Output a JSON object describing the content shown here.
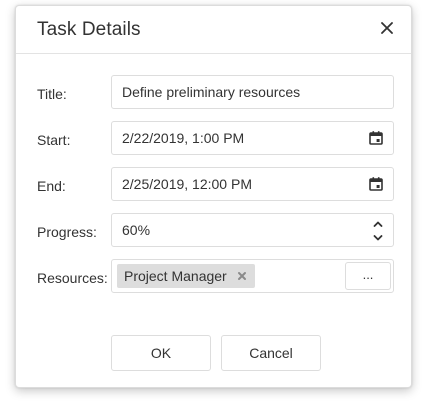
{
  "dialog": {
    "title": "Task Details",
    "close_icon": "close-icon"
  },
  "form": {
    "title": {
      "label": "Title:",
      "value": "Define preliminary resources"
    },
    "start": {
      "label": "Start:",
      "value": "2/22/2019, 1:00 PM",
      "icon": "calendar-icon"
    },
    "end": {
      "label": "End:",
      "value": "2/25/2019, 12:00 PM",
      "icon": "calendar-icon"
    },
    "progress": {
      "label": "Progress:",
      "value": "60%",
      "up_icon": "chevron-up-icon",
      "down_icon": "chevron-down-icon"
    },
    "resources": {
      "label": "Resources:",
      "tags": [
        {
          "label": "Project Manager",
          "remove_icon": "close-icon"
        }
      ],
      "more_button": "..."
    }
  },
  "buttons": {
    "ok": "OK",
    "cancel": "Cancel"
  }
}
